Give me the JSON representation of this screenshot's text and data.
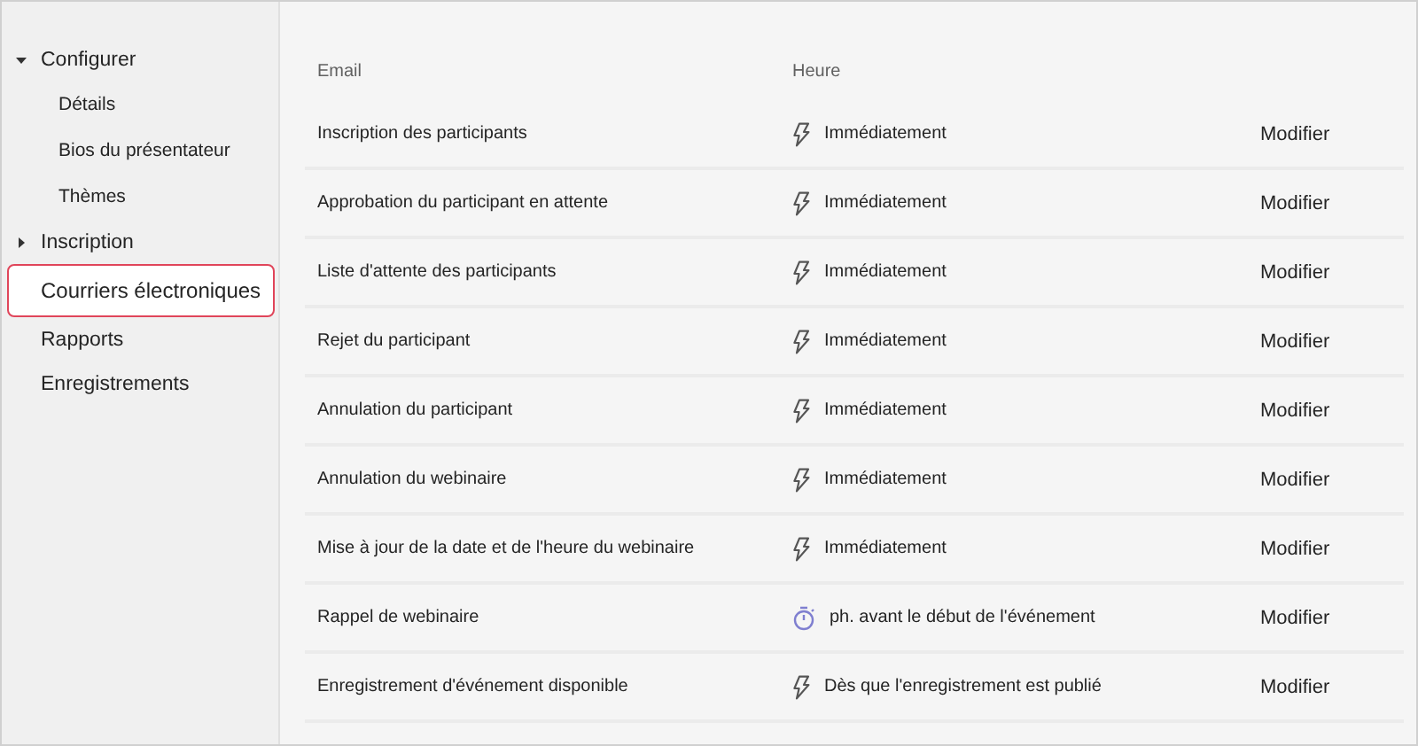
{
  "sidebar": {
    "items": [
      {
        "label": "Configurer",
        "expanded": true,
        "selected": false,
        "children": [
          {
            "label": "Détails",
            "selected": false
          },
          {
            "label": "Bios du présentateur",
            "selected": false
          },
          {
            "label": "Thèmes",
            "selected": false
          }
        ]
      },
      {
        "label": "Inscription",
        "expanded": false,
        "selected": false
      },
      {
        "label": "Courriers électroniques",
        "selected": true
      },
      {
        "label": "Rapports",
        "selected": false
      },
      {
        "label": "Enregistrements",
        "selected": false
      }
    ]
  },
  "table": {
    "columns": [
      "Email",
      "Heure"
    ],
    "rows": [
      {
        "email": "Inscription des participants",
        "kind": "instant",
        "time": "Immédiatement",
        "action": "Modifier"
      },
      {
        "email": "Approbation du participant en attente",
        "kind": "instant",
        "time": "Immédiatement",
        "action": "Modifier"
      },
      {
        "email": "Liste d'attente des participants",
        "kind": "instant",
        "time": "Immédiatement",
        "action": "Modifier"
      },
      {
        "email": "Rejet du participant",
        "kind": "instant",
        "time": "Immédiatement",
        "action": "Modifier"
      },
      {
        "email": "Annulation du participant",
        "kind": "instant",
        "time": "Immédiatement",
        "action": "Modifier"
      },
      {
        "email": "Annulation du webinaire",
        "kind": "instant",
        "time": "Immédiatement",
        "action": "Modifier"
      },
      {
        "email": "Mise à jour de la date et de l'heure du webinaire",
        "kind": "instant",
        "time": "Immédiatement",
        "action": "Modifier"
      },
      {
        "email": "Rappel de webinaire",
        "kind": "timer",
        "time": "ph. avant le début de l'événement",
        "action": "Modifier"
      },
      {
        "email": "Enregistrement d'événement disponible",
        "kind": "instant",
        "time": "Dès que l'enregistrement est publié",
        "action": "Modifier"
      }
    ]
  }
}
